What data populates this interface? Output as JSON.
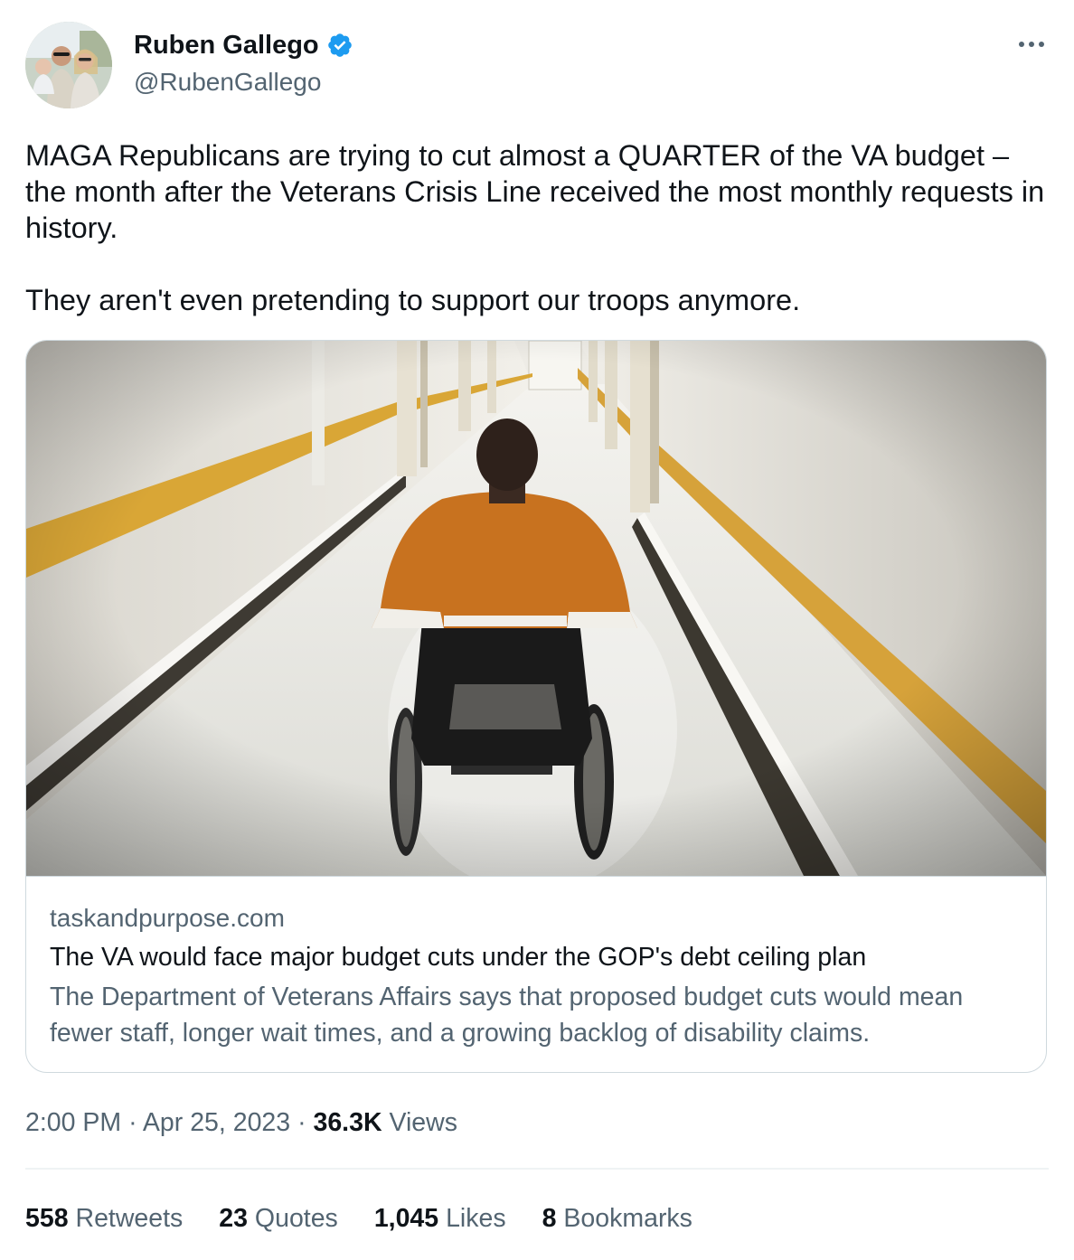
{
  "colors": {
    "text_primary": "#0f1419",
    "text_secondary": "#536471",
    "border": "#cfd9de",
    "verified_blue": "#1d9bf0"
  },
  "author": {
    "name": "Ruben Gallego",
    "handle": "@RubenGallego",
    "verified": true,
    "avatar_icon": "profile-photo"
  },
  "tweet": {
    "paragraphs": [
      "MAGA Republicans are trying to cut almost a QUARTER of the VA budget – the month after the Veterans Crisis Line received the most monthly requests in history.",
      "They aren't even pretending to support our troops anymore."
    ]
  },
  "card": {
    "image_icon": "hospital-hallway-wheelchair-photo",
    "domain": "taskandpurpose.com",
    "title": "The VA would face major budget cuts under the GOP's debt ceiling plan",
    "description": "The Department of Veterans Affairs says that proposed budget cuts would mean fewer staff, longer wait times, and a growing backlog of disability claims."
  },
  "meta": {
    "time": "2:00 PM",
    "separator": "·",
    "date": "Apr 25, 2023",
    "views_count": "36.3K",
    "views_label": "Views"
  },
  "stats": [
    {
      "count": "558",
      "label": "Retweets"
    },
    {
      "count": "23",
      "label": "Quotes"
    },
    {
      "count": "1,045",
      "label": "Likes"
    },
    {
      "count": "8",
      "label": "Bookmarks"
    }
  ]
}
